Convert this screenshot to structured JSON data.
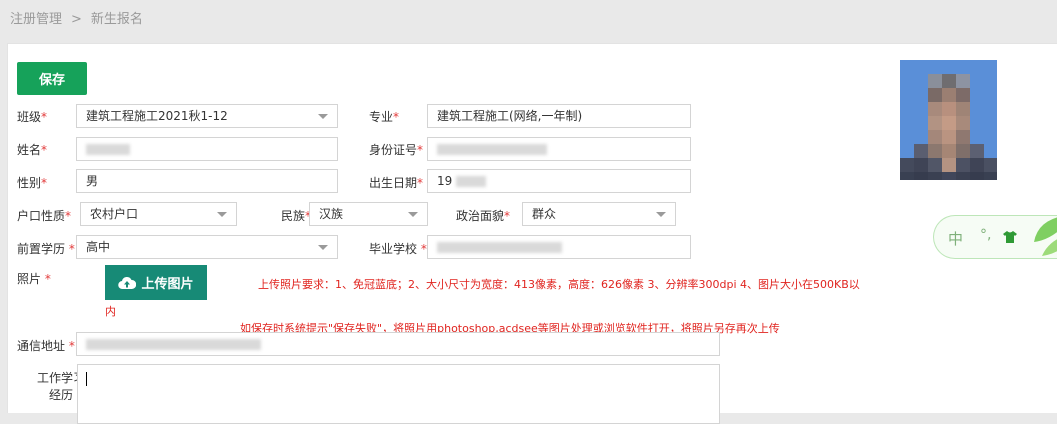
{
  "breadcrumb": {
    "parent": "注册管理",
    "separator": ">",
    "current": "新生报名"
  },
  "toolbar": {
    "save_label": "保存"
  },
  "required_mark": "*",
  "form": {
    "class": {
      "label": "班级",
      "value": "建筑工程施工2021秋1-12"
    },
    "major": {
      "label": "专业",
      "value": "建筑工程施工(网络,一年制)"
    },
    "name": {
      "label": "姓名",
      "value": ""
    },
    "id_number": {
      "label": "身份证号",
      "value": ""
    },
    "gender": {
      "label": "性别",
      "value": "男"
    },
    "birth_date": {
      "label": "出生日期",
      "value": "19"
    },
    "hukou": {
      "label": "户口性质",
      "value": "农村户口"
    },
    "ethnicity": {
      "label": "民族",
      "value": "汉族"
    },
    "political": {
      "label": "政治面貌",
      "value": "群众"
    },
    "education": {
      "label": "前置学历",
      "value": "高中"
    },
    "school": {
      "label": "毕业学校",
      "value": ""
    },
    "photo": {
      "label": "照片",
      "upload_label": "上传图片"
    },
    "address": {
      "label": "通信地址",
      "value": ""
    },
    "experience": {
      "label_line1": "工作学习",
      "label_line2": "经历",
      "value": ""
    }
  },
  "notes": {
    "photo_requirements_line1": "上传照片要求：1、免冠蓝底；2、大小尺寸为宽度：413像素，高度：626像素 3、分辨率300dpi 4、图片大小在500KB以",
    "photo_requirements_line2": "内",
    "save_fail_hint": "如保存时系统提示\"保存失败\"，将照片用photoshop,acdsee等图片处理或浏览软件打开，将照片另存再次上传"
  },
  "ime": {
    "mode": "中",
    "punct": "°,"
  },
  "icons": {
    "upload": "cloud-upload-icon",
    "dropdown": "chevron-down-icon",
    "ime_skin": "shirt-icon"
  },
  "colors": {
    "save_button": "#16a25a",
    "upload_button": "#178a76",
    "required": "#e23a3a",
    "note": "#e0241f"
  }
}
